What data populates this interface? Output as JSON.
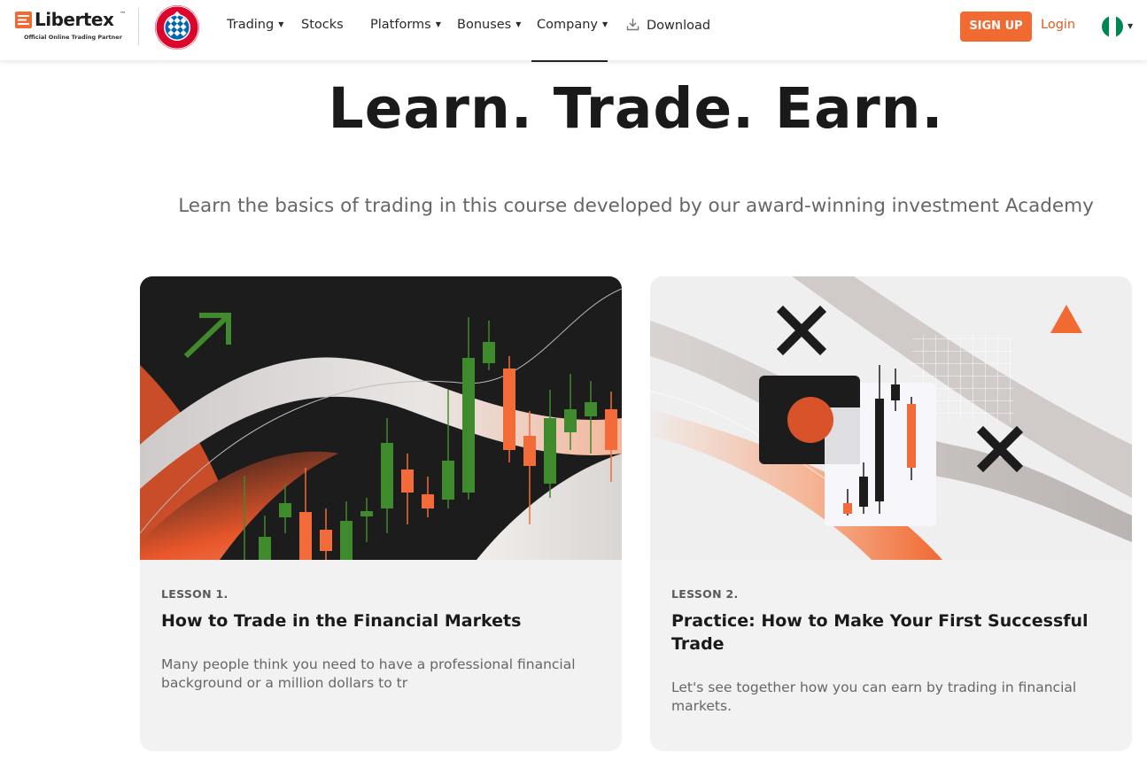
{
  "header": {
    "logo_text": "Libertex",
    "logo_trademark": "™",
    "logo_tagline": "Official Online Trading Partner",
    "partner_badge_icon": "club-crest-icon",
    "nav": [
      {
        "label": "Trading",
        "has_dropdown": true
      },
      {
        "label": "Stocks",
        "has_dropdown": false
      },
      {
        "label": "Platforms",
        "has_dropdown": true
      },
      {
        "label": "Bonuses",
        "has_dropdown": true
      },
      {
        "label": "Company",
        "has_dropdown": true
      },
      {
        "label": "Download",
        "has_dropdown": false,
        "icon": "download-icon"
      }
    ],
    "signup_label": "SIGN UP",
    "login_label": "Login",
    "language_flag_icon": "nigeria-flag-icon"
  },
  "hero": {
    "title": "Learn. Trade. Earn.",
    "subtitle": "Learn the basics of trading in this course developed by our award-winning investment Academy"
  },
  "lessons": [
    {
      "label": "LESSON 1.",
      "title": "How to Trade in the Financial Markets",
      "description": "Many people think you need to have a professional financial background or a million dollars to tr",
      "image_icon": "candlestick-chart-illustration"
    },
    {
      "label": "LESSON 2.",
      "title": "Practice: How to Make Your First Successful Trade",
      "description": "Let's see together how you can earn by trading in financial markets.",
      "image_icon": "trading-shapes-illustration"
    }
  ],
  "colors": {
    "accent": "#f06a32",
    "link": "#e05a22",
    "card_bg": "#f2f2f2",
    "dark": "#1c1c1c",
    "chart_green": "#3f8a2c"
  }
}
